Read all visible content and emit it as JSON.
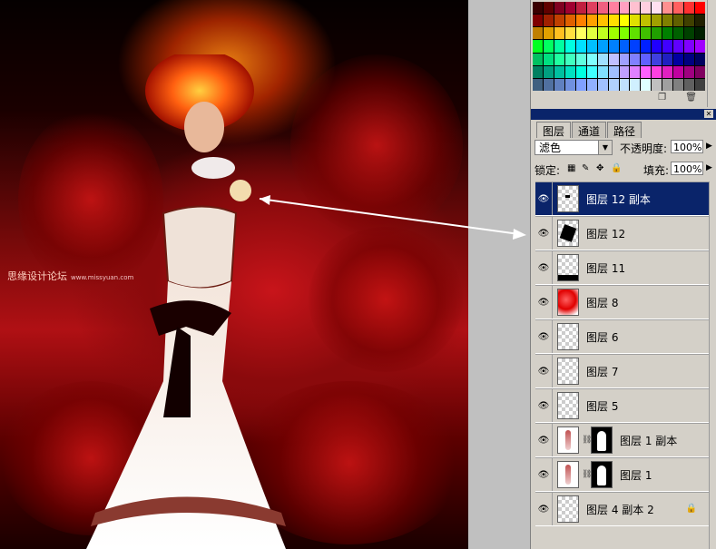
{
  "artwork": {
    "watermark_main": "思缘设计论坛",
    "watermark_url": "www.missyuan.com"
  },
  "swatches": {
    "colors": [
      "#3a0000",
      "#600000",
      "#800020",
      "#a00030",
      "#c02040",
      "#e04060",
      "#f06080",
      "#ff80a0",
      "#ffa0c0",
      "#ffc0d0",
      "#ffd0e0",
      "#ffe0f0",
      "#ff9090",
      "#ff6060",
      "#ff3030",
      "#ff0000",
      "#800000",
      "#a02000",
      "#c04000",
      "#e06000",
      "#ff8000",
      "#ffa000",
      "#ffc000",
      "#ffe000",
      "#ffff00",
      "#e0e000",
      "#c0c000",
      "#a0a000",
      "#808000",
      "#606000",
      "#404000",
      "#202000",
      "#c08000",
      "#e0a000",
      "#ffc020",
      "#ffe040",
      "#ffff60",
      "#e0ff40",
      "#c0ff20",
      "#a0ff00",
      "#80ff00",
      "#60e000",
      "#40c000",
      "#20a000",
      "#008000",
      "#006000",
      "#004000",
      "#002000",
      "#00ff20",
      "#00ff60",
      "#00ffa0",
      "#00ffe0",
      "#00e0ff",
      "#00c0ff",
      "#00a0ff",
      "#0080ff",
      "#0060ff",
      "#0040ff",
      "#0020ff",
      "#2000ff",
      "#4000ff",
      "#6000ff",
      "#8000ff",
      "#a000ff",
      "#00c060",
      "#00e080",
      "#20ffa0",
      "#40ffc0",
      "#60ffe0",
      "#80ffff",
      "#a0e0ff",
      "#c0c0ff",
      "#a0a0ff",
      "#8080ff",
      "#6060ff",
      "#4040e0",
      "#2020c0",
      "#0000a0",
      "#000080",
      "#000060",
      "#008060",
      "#00a080",
      "#00c0a0",
      "#00e0c0",
      "#00ffe0",
      "#40ffff",
      "#80e0ff",
      "#a0c0ff",
      "#c0a0ff",
      "#e080ff",
      "#ff60ff",
      "#ff40e0",
      "#e020c0",
      "#c000a0",
      "#a00080",
      "#800060",
      "#406080",
      "#5070a0",
      "#6080c0",
      "#7090e0",
      "#80a0ff",
      "#90b0ff",
      "#a0c0ff",
      "#b0d0ff",
      "#c0e0ff",
      "#d0f0ff",
      "#e0ffff",
      "#c0c0c0",
      "#a0a0a0",
      "#808080",
      "#606060",
      "#404040"
    ]
  },
  "layers_panel": {
    "tabs": [
      {
        "label": "图层"
      },
      {
        "label": "通道"
      },
      {
        "label": "路径"
      }
    ],
    "blend_mode": "滤色",
    "opacity_label": "不透明度:",
    "opacity_value": "100%",
    "lock_label": "锁定:",
    "fill_label": "填充:",
    "fill_value": "100%",
    "layers": [
      {
        "name": "图层 12 副本",
        "selected": true,
        "thumb": "tiny"
      },
      {
        "name": "图层 12",
        "thumb": "dark"
      },
      {
        "name": "图层 11",
        "thumb": "bar"
      },
      {
        "name": "图层 8",
        "thumb": "red"
      },
      {
        "name": "图层 6",
        "thumb": "checker"
      },
      {
        "name": "图层 7",
        "thumb": "checker"
      },
      {
        "name": "图层 5",
        "thumb": "checker"
      },
      {
        "name": "图层 1 副本",
        "thumb": "person",
        "mask": true
      },
      {
        "name": "图层 1",
        "thumb": "person",
        "mask": true
      },
      {
        "name": "图层 4 副本 2",
        "thumb": "checker",
        "locked": true
      }
    ]
  }
}
